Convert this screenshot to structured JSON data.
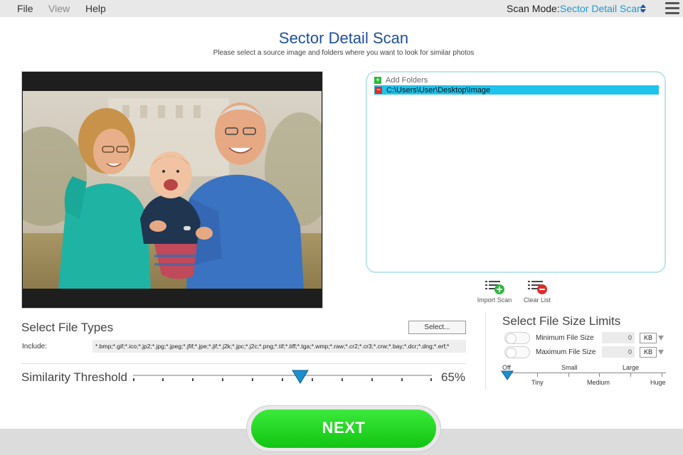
{
  "menu": {
    "items": [
      {
        "label": "File",
        "enabled": true
      },
      {
        "label": "View",
        "enabled": false
      },
      {
        "label": "Help",
        "enabled": true
      }
    ],
    "scan_mode_label": "Scan Mode:",
    "scan_mode_value": "Sector Detail Scan"
  },
  "header": {
    "title": "Sector Detail Scan",
    "subtitle": "Please select a source image and folders where you want to look for similar photos"
  },
  "folders": {
    "add_label": "Add Folders",
    "items": [
      "C:\\Users\\User\\Desktop\\Image"
    ],
    "import_label": "Import Scan",
    "clear_label": "Clear List"
  },
  "file_types": {
    "title": "Select File Types",
    "select_button": "Select...",
    "include_label": "Include:",
    "include_value": "*.bmp;*.gif;*.ico;*.jp2;*.jpg;*.jpeg;*.jfif;*.jpe;*.jif;*.j2k;*.jpc;*.j2c;*.png;*.tif;*.tiff;*.tga;*.wmp;*.raw;*.cr2;*.cr3;*.crw;*.bay;*.dcr;*.dng;*.erf;*"
  },
  "similarity": {
    "title": "Similarity Threshold",
    "value": 65,
    "display": "65%"
  },
  "file_size": {
    "title": "Select File Size Limits",
    "minimum_label": "Minimum File Size",
    "minimum_value": "0",
    "minimum_unit": "KB",
    "maximum_label": "Maximum File Size",
    "maximum_value": "0",
    "maximum_unit": "KB",
    "scale_top": [
      "Off",
      "Small",
      "Large"
    ],
    "scale_bottom": [
      "Tiny",
      "Medium",
      "Huge"
    ],
    "selected": "Off"
  },
  "footer": {
    "next_label": "NEXT"
  },
  "colors": {
    "accent": "#1a9ad6",
    "title": "#1f4e9e",
    "selected_row": "#1ec3ec",
    "next_green": "#12c412",
    "slider_thumb": "#1c8fd0"
  }
}
